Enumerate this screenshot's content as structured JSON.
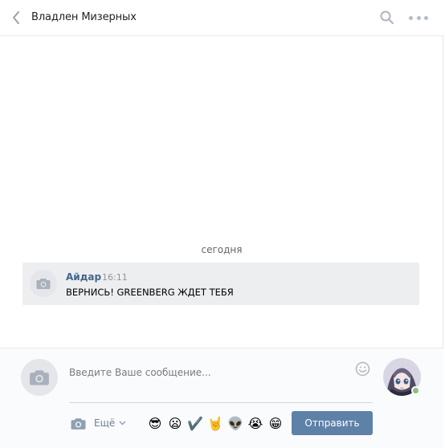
{
  "header": {
    "title": "Владлен Мизерных",
    "back_icon": "chevron-left-icon",
    "search_icon": "search-icon",
    "more_icon": "more-dots-icon"
  },
  "history": {
    "date_label": "сегодня",
    "messages": [
      {
        "author": "Айдар",
        "time": "16:11",
        "text": "ВЕРНИСЬ! GREENBERG ЖДЕТ ТЕБЯ",
        "avatar_icon": "camera-icon"
      }
    ]
  },
  "composer": {
    "placeholder": "Введите Ваше сообщение...",
    "value": "",
    "more_label": "Ещё",
    "send_label": "Отправить",
    "emojis": [
      "😎",
      "😦",
      "✔️",
      "🤘",
      "👽",
      "😭",
      "😁"
    ]
  },
  "colors": {
    "accent": "#5e81a8",
    "author": "#42648b",
    "message_bg": "#edeef0",
    "online": "#8ac176"
  }
}
